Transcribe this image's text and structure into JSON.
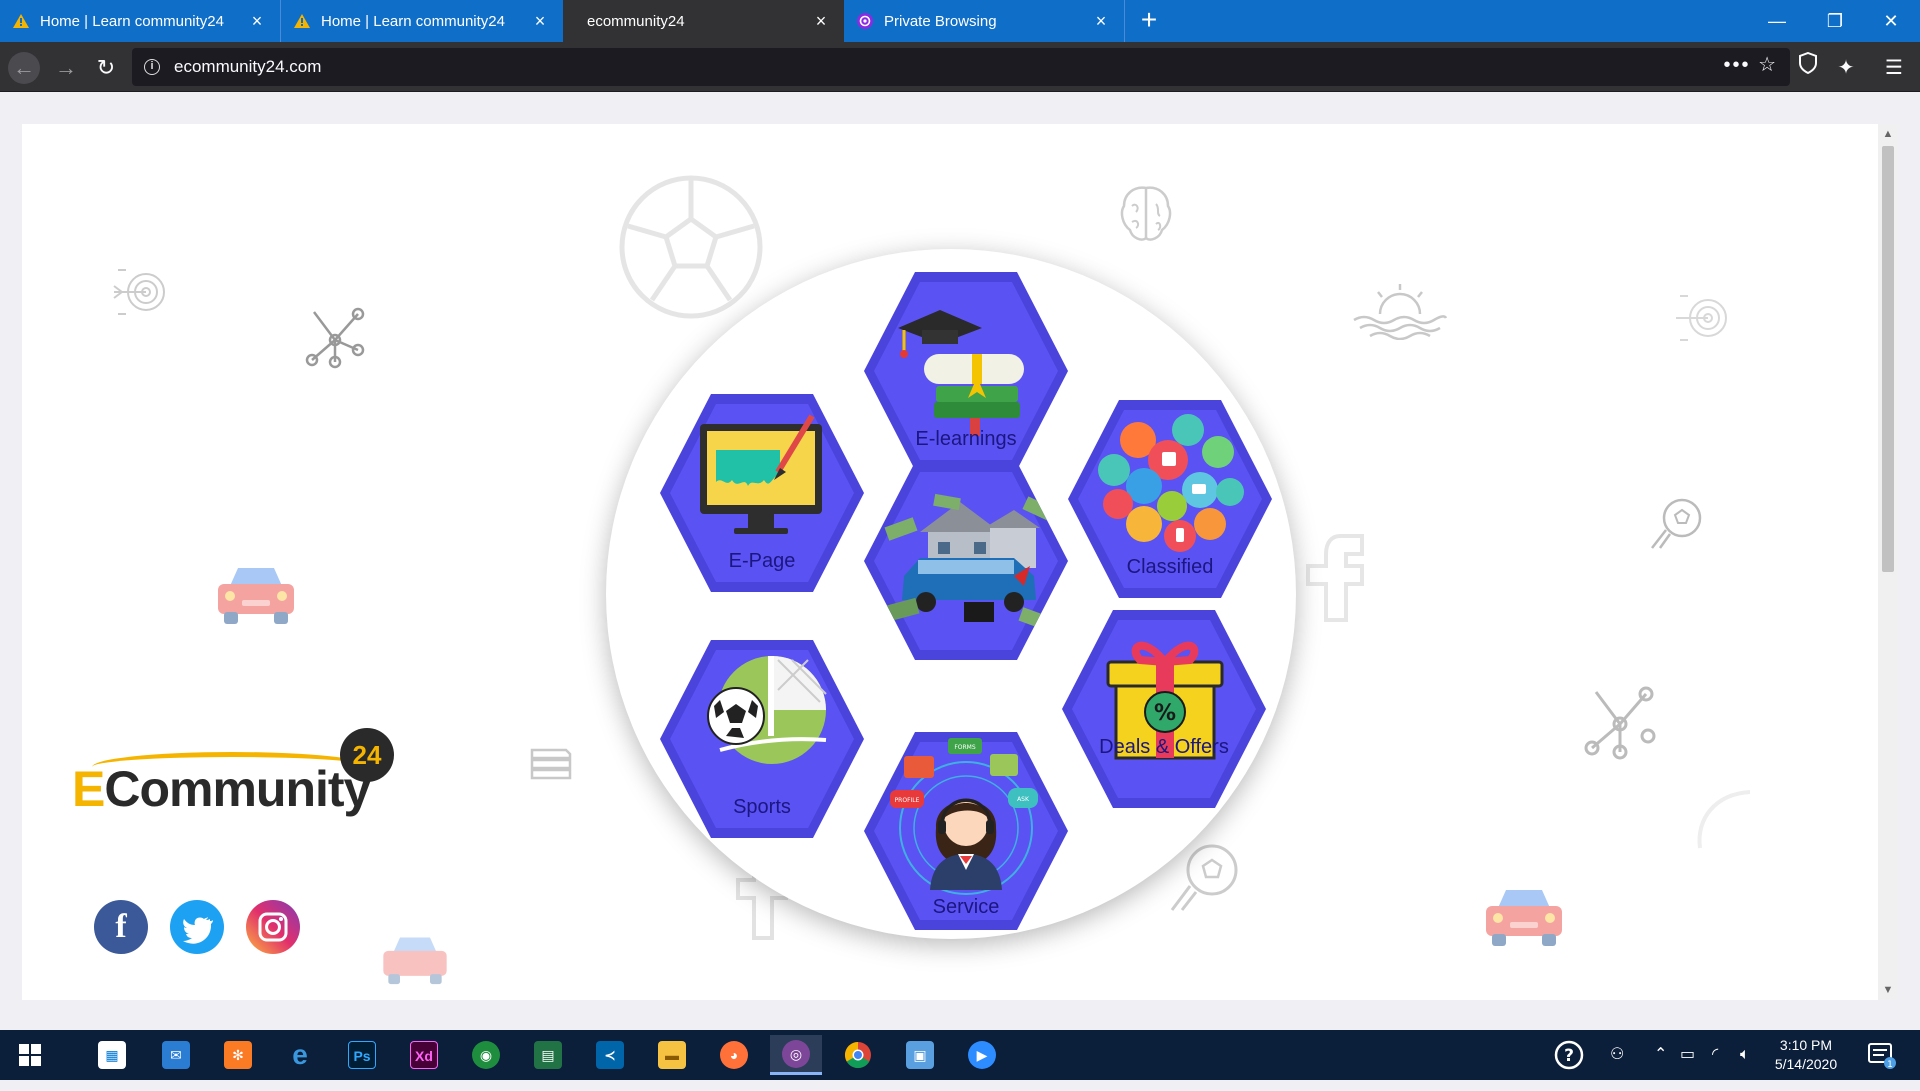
{
  "browser": {
    "tabs": [
      {
        "label": "Home | Learn community24",
        "icon": "warning-triangle-icon",
        "active": false
      },
      {
        "label": "Home | Learn community24",
        "icon": "warning-triangle-icon",
        "active": false
      },
      {
        "label": "ecommunity24",
        "icon": "",
        "active": true
      },
      {
        "label": "Private Browsing",
        "icon": "private-mask-icon",
        "active": false
      }
    ],
    "new_tab": "+",
    "url": "ecommunity24.com",
    "url_actions": "•••",
    "colors": {
      "tabstrip": "#0f6ec7",
      "toolbar": "#323234",
      "urlbar": "#1c1b22"
    }
  },
  "hexagons": {
    "elearnings": "E-learnings",
    "epage": "E-Page",
    "classified": "Classified",
    "sports": "Sports",
    "deals": "Deals & Offers",
    "service": "Service",
    "service_bubbles": {
      "forms": "FORMS",
      "profile": "PROFILE",
      "ask": "ASK"
    }
  },
  "brand": {
    "prefix": "E",
    "name": "Community",
    "badge": "24",
    "accent": "#f5b400"
  },
  "social": {
    "facebook": "f",
    "colors": {
      "facebook": "#3b5998",
      "twitter": "#1da1f2",
      "instagram": "#e1306c"
    }
  },
  "taskbar": {
    "clock_time": "3:10 PM",
    "clock_date": "5/14/2020",
    "notification_count": "1",
    "apps": [
      "start",
      "store",
      "mail",
      "xampp",
      "edge",
      "photoshop",
      "xd",
      "maps",
      "excel-sheet",
      "vscode",
      "explorer",
      "firefox",
      "tor",
      "chrome",
      "control-panel",
      "zoom"
    ],
    "labels": {
      "photoshop": "Ps",
      "xd": "Xd"
    }
  }
}
